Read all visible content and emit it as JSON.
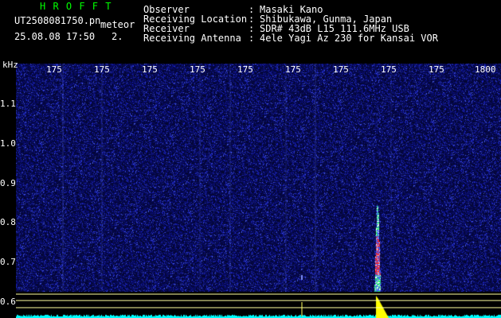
{
  "header": {
    "brand": "H R O F F T",
    "filename": "UT2508081750.pn",
    "meteor_label": "meteor",
    "timestamp": "25.08.08 17:50",
    "count": "2."
  },
  "info": {
    "separator": ":",
    "rows": [
      {
        "label": "Observer",
        "value": "Masaki Kano"
      },
      {
        "label": "Receiving Location",
        "value": "Shibukawa, Gunma, Japan"
      },
      {
        "label": "Receiver",
        "value": "SDR# 43dB L15 111.6MHz USB"
      },
      {
        "label": "Receiving Antenna",
        "value": "4ele Yagi Az 230 for Kansai VOR"
      }
    ]
  },
  "chart_data": {
    "type": "heatmap",
    "ylabel": "kHz",
    "y_ticks": [
      "1.1",
      "1.0",
      "0.9",
      "0.8",
      "0.7",
      "0.6"
    ],
    "x_ticks": [
      "175",
      "175",
      "175",
      "175",
      "175",
      "175",
      "175",
      "175",
      "175",
      "1800"
    ],
    "ylim": [
      0.58,
      1.17
    ],
    "meteor_echo": {
      "time_fraction": 0.745,
      "freq_khz_from": 0.84,
      "freq_khz_to": 0.58
    },
    "colors": {
      "background": "#000000",
      "noise_dark": "#0a0f58",
      "noise_light": "#3040d0",
      "echo_hot": "#ff2020",
      "echo_mid": "#20ff60",
      "ref_line": "#ffffa0",
      "trace": "#00ffff",
      "echo_fill": "#ffff00"
    }
  }
}
